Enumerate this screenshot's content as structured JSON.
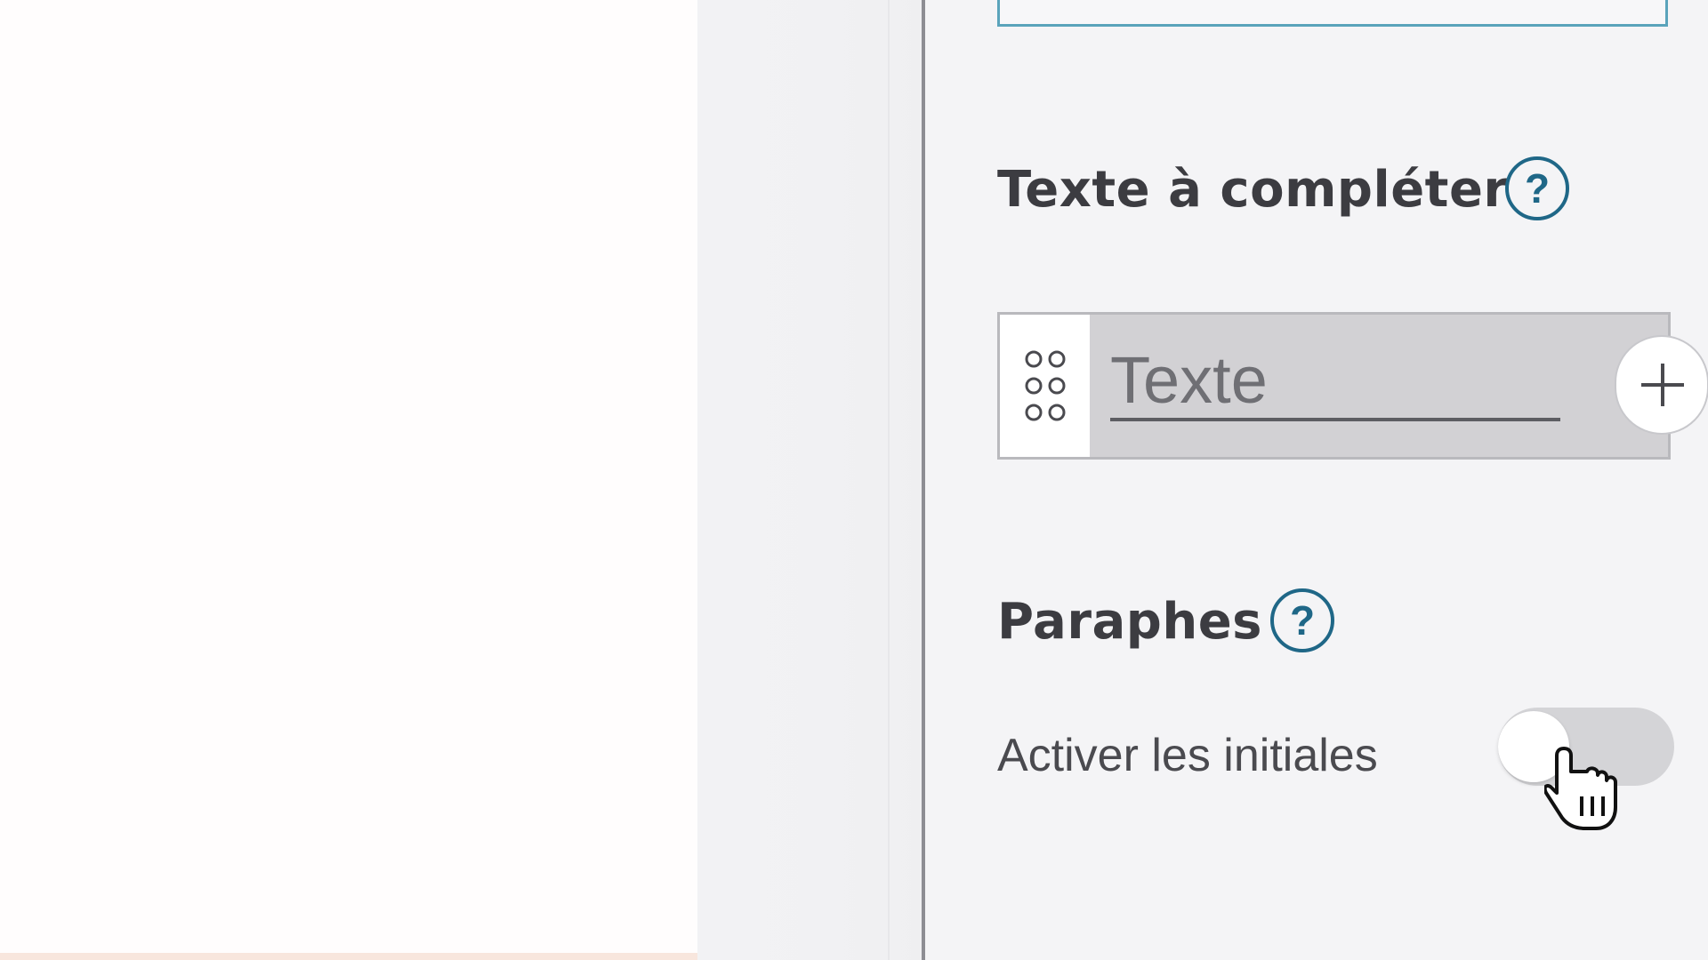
{
  "panel": {
    "text_section": {
      "title": "Texte à compléter",
      "help_glyph": "?",
      "field_placeholder": "Texte"
    },
    "initials_section": {
      "title": "Paraphes",
      "help_glyph": "?",
      "toggle_label": "Activer les initiales",
      "toggle_on": false
    }
  },
  "icons": {
    "drag": "drag-handle-icon",
    "add": "plus-icon",
    "help": "question-mark-icon",
    "cursor": "hand-pointer-icon"
  },
  "colors": {
    "accent": "#1f6787",
    "field_border_active": "#5aa3bb",
    "panel_bg": "#f4f4f6",
    "field_bg": "#d2d1d4",
    "toggle_off": "#d4d4d7"
  }
}
